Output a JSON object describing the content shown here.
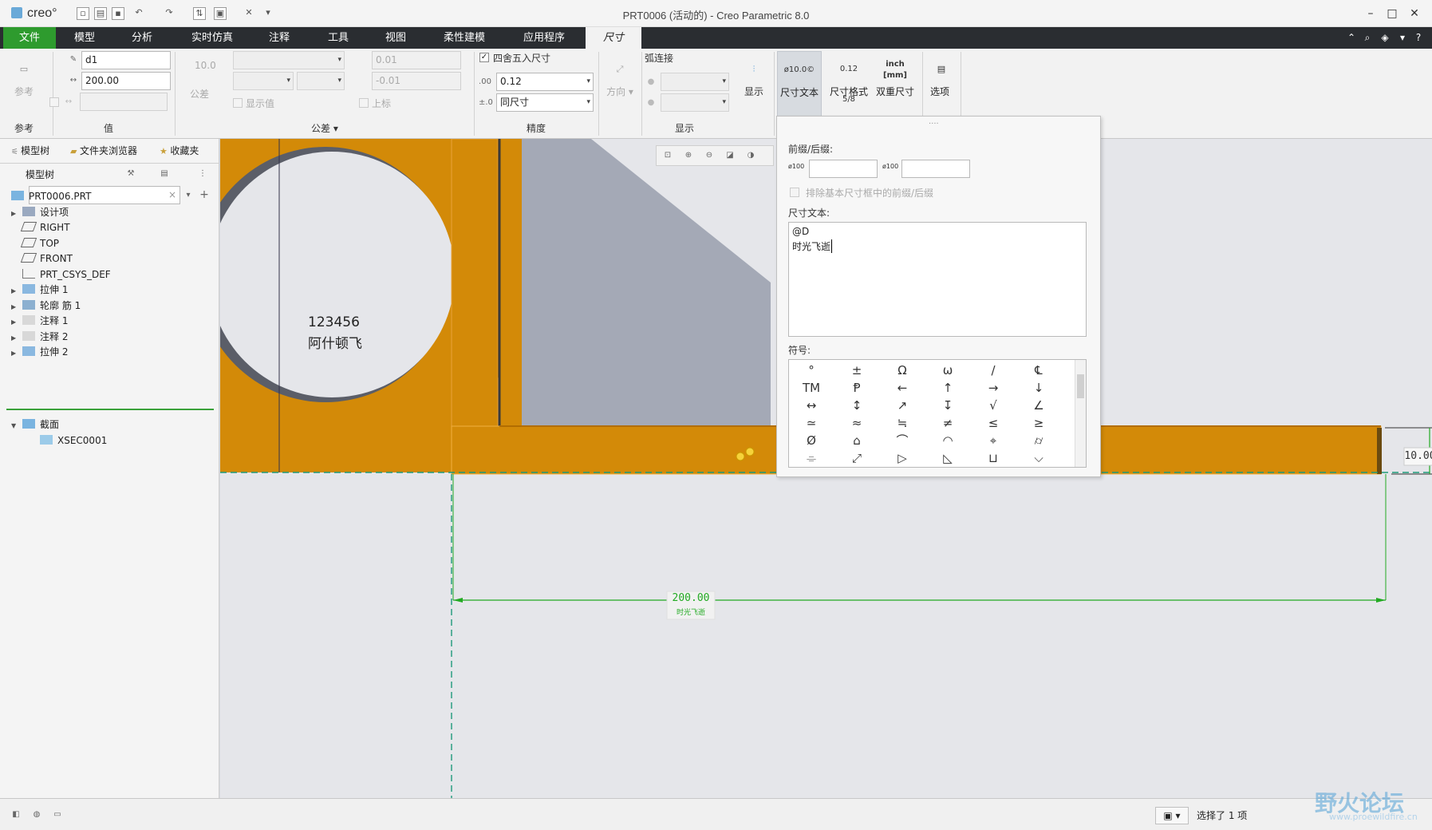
{
  "app": {
    "logo": "creo°",
    "title": "PRT0006 (活动的) - Creo Parametric 8.0"
  },
  "quick_access": [
    "new-icon",
    "open-icon",
    "save-icon",
    "undo-icon",
    "redo-icon",
    "regenerate-icon",
    "windows-icon",
    "close-window-icon",
    "customize-icon"
  ],
  "window_controls": {
    "minimize": "–",
    "maximize": "□",
    "close": "✕"
  },
  "menu": {
    "tabs": [
      "文件",
      "模型",
      "分析",
      "实时仿真",
      "注释",
      "工具",
      "视图",
      "柔性建模",
      "应用程序",
      "尺寸"
    ],
    "active": "尺寸"
  },
  "ribbon": {
    "reference": {
      "button": "参考",
      "group_label": "参考"
    },
    "value": {
      "name_field": "d1",
      "value_field": "200.00",
      "group_label": "值"
    },
    "tolerance": {
      "nominal": "10.0",
      "tol_button": "公差",
      "upper": "0.01",
      "lower": "-0.01",
      "show_value": "显示值",
      "superscript": "上标",
      "group_label": "公差"
    },
    "precision": {
      "round_label": "四舍五入尺寸",
      "decimal_value": "0.12",
      "scope_value": "同尺寸",
      "group_label": "精度"
    },
    "display": {
      "direction": "方向",
      "arc_join": "弧连接",
      "show": "显示",
      "group_label": "显示"
    },
    "dim_text": {
      "label": "尺寸文本",
      "icon_text": "ø10.0©"
    },
    "dim_format": {
      "label": "尺寸格式",
      "icon_text": "0.12 5/8"
    },
    "dual_dim": {
      "label": "双重尺寸",
      "icon_text": "inch [mm]"
    },
    "options": {
      "label": "选项"
    }
  },
  "left_panel": {
    "tabs": [
      "模型树",
      "文件夹浏览器",
      "收藏夹"
    ],
    "tree_header": "模型树",
    "search_placeholder": "",
    "items": [
      {
        "label": "PRT0006.PRT",
        "icon": "part-icon",
        "level": 0,
        "expandable": false
      },
      {
        "label": "设计项",
        "icon": "design-items-icon",
        "level": 1,
        "expandable": true
      },
      {
        "label": "RIGHT",
        "icon": "datum-plane-icon",
        "level": 1,
        "expandable": false
      },
      {
        "label": "TOP",
        "icon": "datum-plane-icon",
        "level": 1,
        "expandable": false
      },
      {
        "label": "FRONT",
        "icon": "datum-plane-icon",
        "level": 1,
        "expandable": false
      },
      {
        "label": "PRT_CSYS_DEF",
        "icon": "csys-icon",
        "level": 1,
        "expandable": false
      },
      {
        "label": "拉伸 1",
        "icon": "extrude-icon",
        "level": 1,
        "expandable": true
      },
      {
        "label": "轮廓 筋 1",
        "icon": "rib-icon",
        "level": 1,
        "expandable": true
      },
      {
        "label": "注释 1",
        "icon": "annotation-icon",
        "level": 1,
        "expandable": true
      },
      {
        "label": "注释 2",
        "icon": "annotation-icon",
        "level": 1,
        "expandable": true
      },
      {
        "label": "拉伸 2",
        "icon": "extrude-icon",
        "level": 1,
        "expandable": true
      }
    ],
    "section_header": "截面",
    "section_items": [
      "XSEC0001"
    ]
  },
  "graphics": {
    "note_line1": "123456",
    "note_line2": "阿什顿飞",
    "dim_main_value": "200.00",
    "dim_main_text": "时光飞逝",
    "dim_side_value": "10.00",
    "colors": {
      "part": "#d38a08",
      "background": "#e5e6ea",
      "rib": "#a4a9b6",
      "dimension": "#22aa22"
    },
    "toolbar_icons": [
      "refit-icon",
      "zoom-in-icon",
      "zoom-out-icon",
      "repaint-icon",
      "view-manager-icon"
    ]
  },
  "popup": {
    "prefix_suffix_label": "前缀/后缀:",
    "prefix_icon": "ø100",
    "suffix_icon": "ø100",
    "exclude_label": "排除基本尺寸框中的前缀/后缀",
    "dim_text_label": "尺寸文本:",
    "dim_text_line1": "@D",
    "dim_text_line2": "时光飞逝",
    "symbols_label": "符号:",
    "symbols": [
      "°",
      "±",
      "Ω",
      "ω",
      "/",
      "℄",
      "TM",
      "Ᵽ",
      "←",
      "↑",
      "→",
      "↓",
      "↔",
      "↕",
      "↗",
      "↧",
      "√",
      "∠",
      "≃",
      "≈",
      "≒",
      "≠",
      "≤",
      "≥",
      "Ø",
      "⌂",
      "⌒",
      "◠",
      "⌖",
      "⌭",
      "⌯",
      "⤢",
      "▷",
      "◺",
      "⊔",
      "⌵"
    ]
  },
  "status": {
    "selected_text": "选择了 1 项",
    "filter_icon": "filter-icon"
  },
  "watermark": {
    "text": "野火论坛",
    "url": "www.proewildfire.cn"
  }
}
